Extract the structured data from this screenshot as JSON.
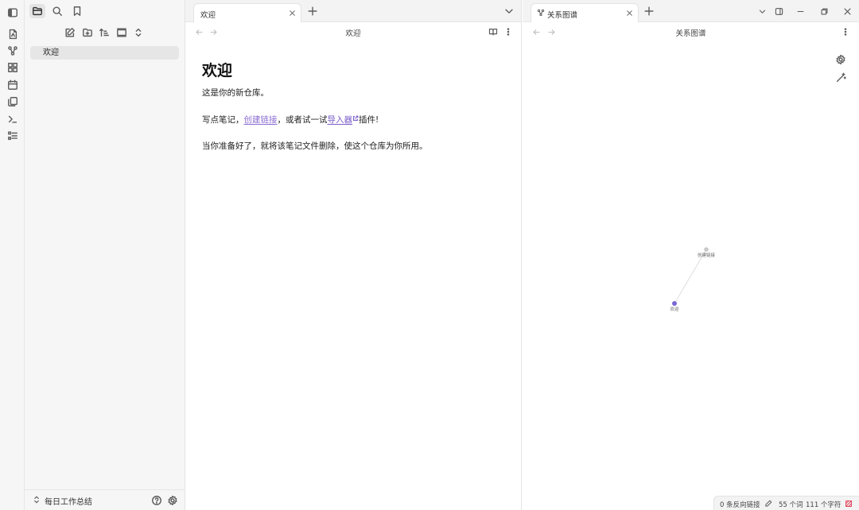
{
  "sidebar": {
    "vault_name": "每日工作总结",
    "files": [
      {
        "name": "欢迎"
      }
    ]
  },
  "left_pane": {
    "tab_label": "欢迎",
    "view_title": "欢迎",
    "note": {
      "heading": "欢迎",
      "line1": "这是你的新仓库。",
      "line2_prefix": "写点笔记，",
      "line2_link": "创建链接",
      "line2_mid": "，或者试一试",
      "line2_ext": "导入器",
      "line2_suffix": "插件!",
      "line3": "当你准备好了，就将该笔记文件删除，使这个仓库为你所用。"
    }
  },
  "right_pane": {
    "tab_label": "关系图谱",
    "view_title": "关系图谱",
    "graph": {
      "nodes": [
        {
          "label": "创建链接",
          "color": "#c8c8c8"
        },
        {
          "label": "欢迎",
          "color": "#7b68d6"
        }
      ]
    }
  },
  "statusbar": {
    "backlinks": "0 条反向链接",
    "words": "55 个词",
    "chars": "111 个字符"
  },
  "colors": {
    "accent": "#8b6cd1",
    "node_active": "#7b68d6",
    "sync_icon": "#e0455a"
  }
}
